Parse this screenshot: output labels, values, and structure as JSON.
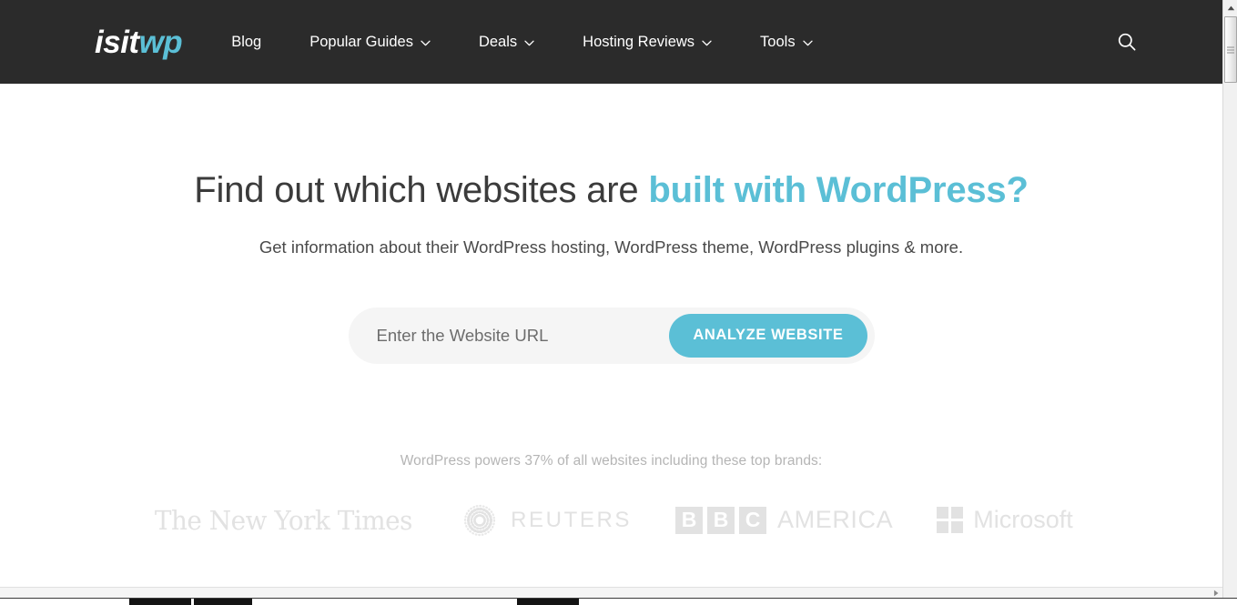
{
  "header": {
    "logo": {
      "part1": "isit",
      "part2": "wp"
    },
    "nav": [
      {
        "label": "Blog",
        "has_dropdown": false,
        "name": "nav-item-blog"
      },
      {
        "label": "Popular Guides",
        "has_dropdown": true,
        "name": "nav-item-popular-guides"
      },
      {
        "label": "Deals",
        "has_dropdown": true,
        "name": "nav-item-deals"
      },
      {
        "label": "Hosting Reviews",
        "has_dropdown": true,
        "name": "nav-item-hosting-reviews"
      },
      {
        "label": "Tools",
        "has_dropdown": true,
        "name": "nav-item-tools"
      }
    ],
    "search_icon": "search-icon",
    "background_color": "#2b2b2b"
  },
  "hero": {
    "title_plain": "Find out which websites are ",
    "title_accent": "built with WordPress?",
    "subtitle": "Get information about their WordPress hosting, WordPress theme, WordPress plugins & more.",
    "accent_color": "#5bbfd6"
  },
  "form": {
    "input_placeholder": "Enter the Website URL",
    "input_value": "",
    "button_label": "ANALYZE WEBSITE",
    "button_color": "#5bbfd6",
    "field_background": "#f5f5f5"
  },
  "brands": {
    "caption": "WordPress powers 37% of all websites including these top brands:",
    "logos": [
      {
        "name": "brand-logo-nyt",
        "text": "The New York Times",
        "icon": "nyt-wordmark"
      },
      {
        "name": "brand-logo-reuters",
        "text": "REUTERS",
        "icon": "reuters-dotted-circle-icon"
      },
      {
        "name": "brand-logo-bbc-america",
        "text": "AMERICA",
        "letters": [
          "B",
          "B",
          "C"
        ],
        "icon": "bbc-boxes-icon"
      },
      {
        "name": "brand-logo-microsoft",
        "text": "Microsoft",
        "icon": "microsoft-squares-icon"
      }
    ],
    "logo_color": "#e2e2e2"
  },
  "chrome": {
    "vertical_scrollbar": {
      "up_arrow": "scroll-up-arrow-icon",
      "down_arrow": "scroll-down-arrow-icon"
    },
    "horizontal_scrollbar": {
      "right_arrow": "scroll-right-arrow-icon"
    }
  }
}
